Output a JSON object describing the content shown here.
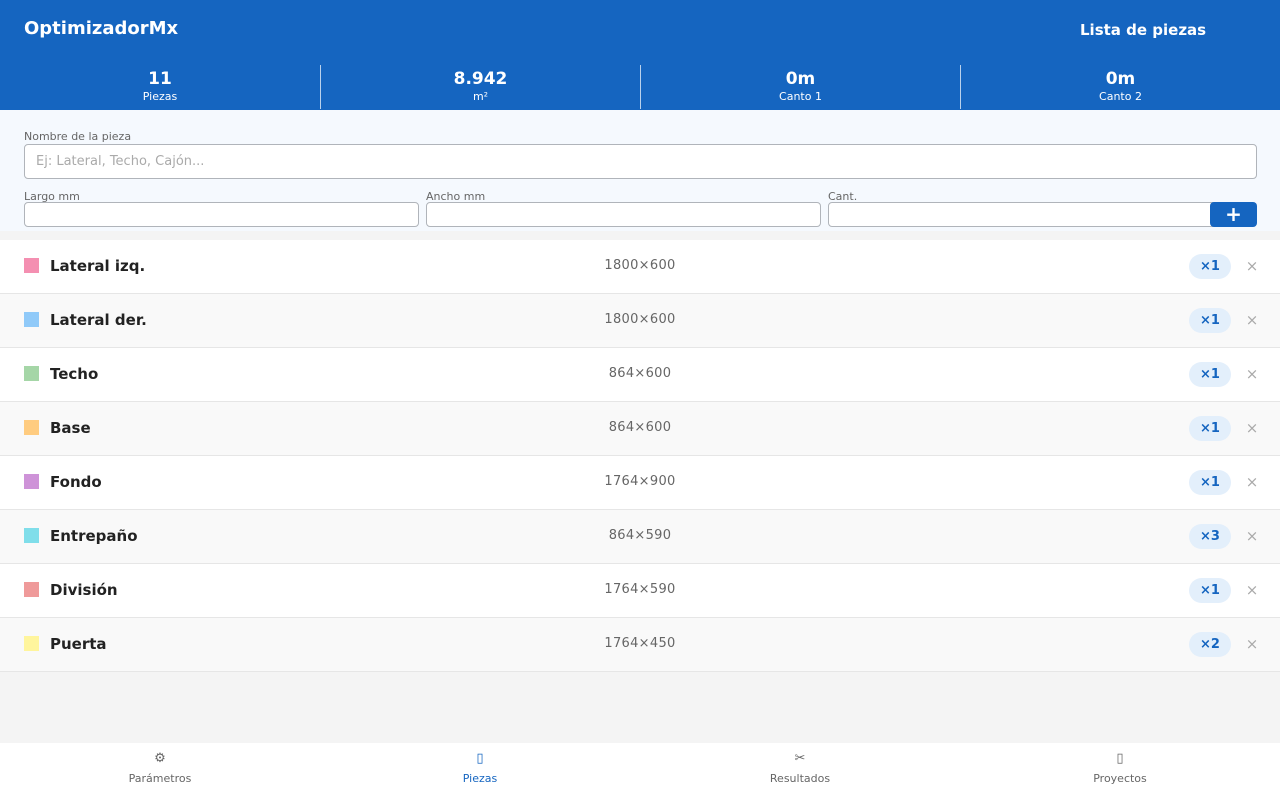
{
  "app": {
    "title": "OptimizadorMx",
    "section_title": "Lista de piezas"
  },
  "stats": [
    {
      "value": "11",
      "label": "Piezas"
    },
    {
      "value": "8.942",
      "label": "m²"
    },
    {
      "value": "0m",
      "label": "Canto 1"
    },
    {
      "value": "0m",
      "label": "Canto 2"
    }
  ],
  "form": {
    "name_label": "Nombre de la pieza",
    "name_placeholder": "Ej: Lateral, Techo, Cajón...",
    "name_value": "",
    "largo_label": "Largo mm",
    "largo_value": "",
    "ancho_label": "Ancho mm",
    "ancho_value": "",
    "cant_label": "Cant.",
    "cant_value": "",
    "add_label": "+"
  },
  "pieces": [
    {
      "name": "Lateral izq.",
      "dims": "1800×600",
      "qty": "×1",
      "color": "#f48fb1"
    },
    {
      "name": "Lateral der.",
      "dims": "1800×600",
      "qty": "×1",
      "color": "#90caf9"
    },
    {
      "name": "Techo",
      "dims": "864×600",
      "qty": "×1",
      "color": "#a5d6a7"
    },
    {
      "name": "Base",
      "dims": "864×600",
      "qty": "×1",
      "color": "#ffcc80"
    },
    {
      "name": "Fondo",
      "dims": "1764×900",
      "qty": "×1",
      "color": "#ce93d8"
    },
    {
      "name": "Entrepaño",
      "dims": "864×590",
      "qty": "×3",
      "color": "#80deea"
    },
    {
      "name": "División",
      "dims": "1764×590",
      "qty": "×1",
      "color": "#ef9a9a"
    },
    {
      "name": "Puerta",
      "dims": "1764×450",
      "qty": "×2",
      "color": "#fff59d"
    }
  ],
  "delete_glyph": "×",
  "nav": [
    {
      "icon": "gear-icon",
      "glyph": "⚙",
      "label": "Parámetros",
      "active": false
    },
    {
      "icon": "pieces-icon",
      "glyph": "▯",
      "label": "Piezas",
      "active": true
    },
    {
      "icon": "scissors-icon",
      "glyph": "✂",
      "label": "Resultados",
      "active": false
    },
    {
      "icon": "projects-icon",
      "glyph": "▯",
      "label": "Proyectos",
      "active": false
    }
  ],
  "colors": {
    "primary": "#1565c0",
    "chip_bg": "#e3effb"
  }
}
